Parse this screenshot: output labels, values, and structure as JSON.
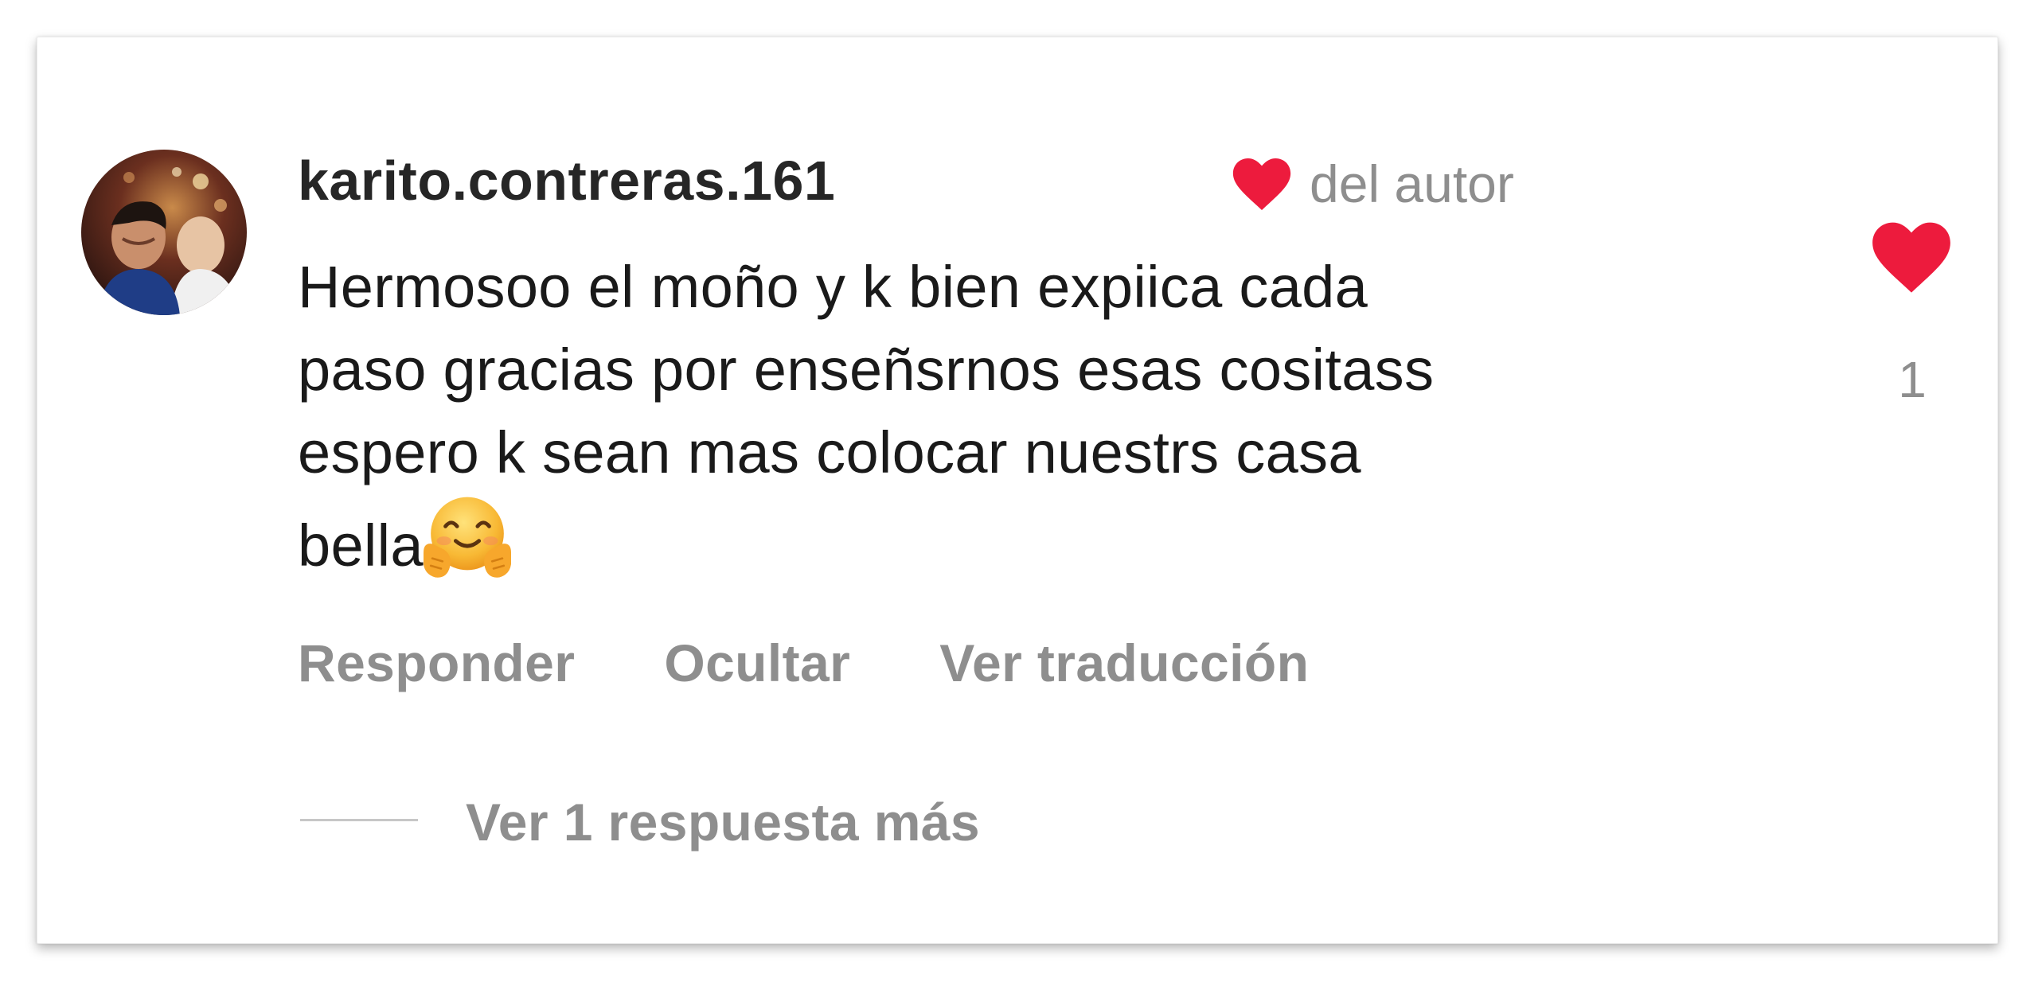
{
  "comment": {
    "username": "karito.contreras.161",
    "author_like_label": "del autor",
    "text_lines": [
      "Hermosoo el moño y k bien expiica cada",
      "paso gracias por enseñsrnos esas cositass",
      "espero k sean mas colocar nuestrs casa",
      "bella"
    ],
    "emoji": "smiling-face-with-open-hands-emoji",
    "like_count": "1",
    "heart_color": "#ed1b3d"
  },
  "actions": {
    "reply": "Responder",
    "hide": "Ocultar",
    "translate": "Ver traducción"
  },
  "replies": {
    "view_more": "Ver 1 respuesta más"
  }
}
